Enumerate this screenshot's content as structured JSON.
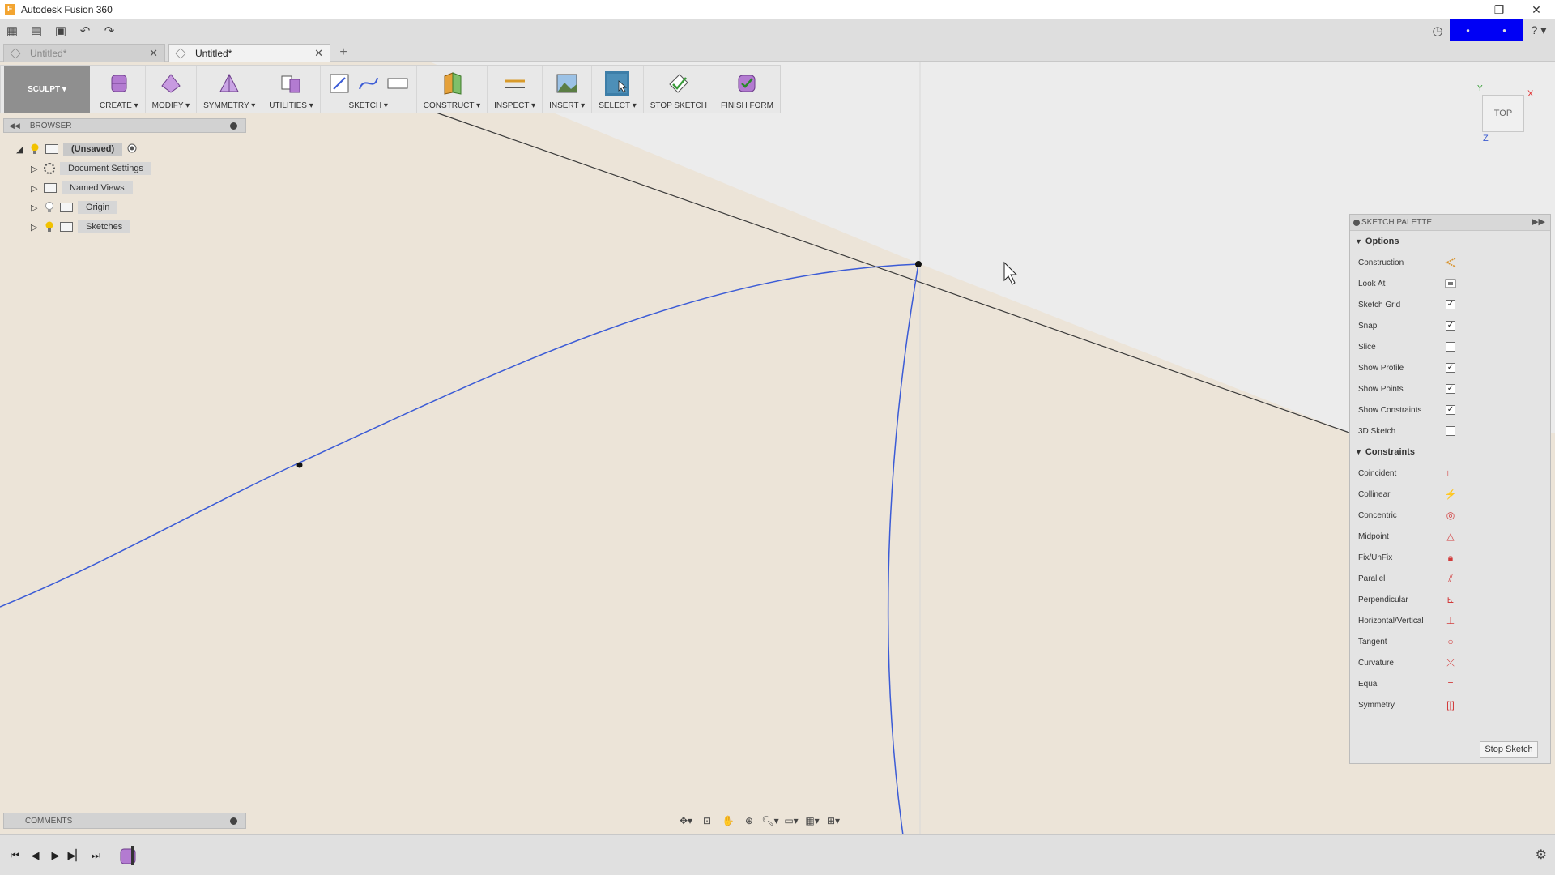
{
  "window": {
    "title": "Autodesk Fusion 360",
    "app_letter": "F",
    "minimize": "–",
    "restore": "❐",
    "close": "✕"
  },
  "tabs": [
    {
      "label": "Untitled*",
      "active": false
    },
    {
      "label": "Untitled*",
      "active": true
    }
  ],
  "tab_close": "✕",
  "new_tab": "+",
  "toolbar": {
    "workspace": "SCULPT ▾",
    "groups": [
      {
        "label": "CREATE ▾"
      },
      {
        "label": "MODIFY ▾"
      },
      {
        "label": "SYMMETRY ▾"
      },
      {
        "label": "UTILITIES ▾"
      },
      {
        "label": "SKETCH ▾"
      },
      {
        "label": "CONSTRUCT ▾"
      },
      {
        "label": "INSPECT ▾"
      },
      {
        "label": "INSERT ▾"
      },
      {
        "label": "SELECT ▾"
      },
      {
        "label": "STOP SKETCH"
      },
      {
        "label": "FINISH FORM"
      }
    ]
  },
  "browser": {
    "title": "BROWSER",
    "root": "(Unsaved)",
    "nodes": [
      "Document Settings",
      "Named Views",
      "Origin",
      "Sketches"
    ]
  },
  "viewcube": {
    "face": "TOP",
    "x": "X",
    "y": "Y",
    "z": "Z"
  },
  "palette": {
    "title": "SKETCH PALETTE",
    "options_title": "Options",
    "options": [
      {
        "label": "Construction",
        "checked": null
      },
      {
        "label": "Look At",
        "checked": null
      },
      {
        "label": "Sketch Grid",
        "checked": true
      },
      {
        "label": "Snap",
        "checked": true
      },
      {
        "label": "Slice",
        "checked": false
      },
      {
        "label": "Show Profile",
        "checked": true
      },
      {
        "label": "Show Points",
        "checked": true
      },
      {
        "label": "Show Constraints",
        "checked": true
      },
      {
        "label": "3D Sketch",
        "checked": false
      }
    ],
    "constraints_title": "Constraints",
    "constraints": [
      "Coincident",
      "Collinear",
      "Concentric",
      "Midpoint",
      "Fix/UnFix",
      "Parallel",
      "Perpendicular",
      "Horizontal/Vertical",
      "Tangent",
      "Curvature",
      "Equal",
      "Symmetry"
    ],
    "stop_button": "Stop Sketch"
  },
  "comments": {
    "title": "COMMENTS"
  },
  "colors": {
    "canvas": "#ece4d8",
    "canvas_light": "#ececec",
    "curve": "#3b5bd6",
    "accent_blue": "#0000f5",
    "constraint_red": "#d23b3b"
  }
}
